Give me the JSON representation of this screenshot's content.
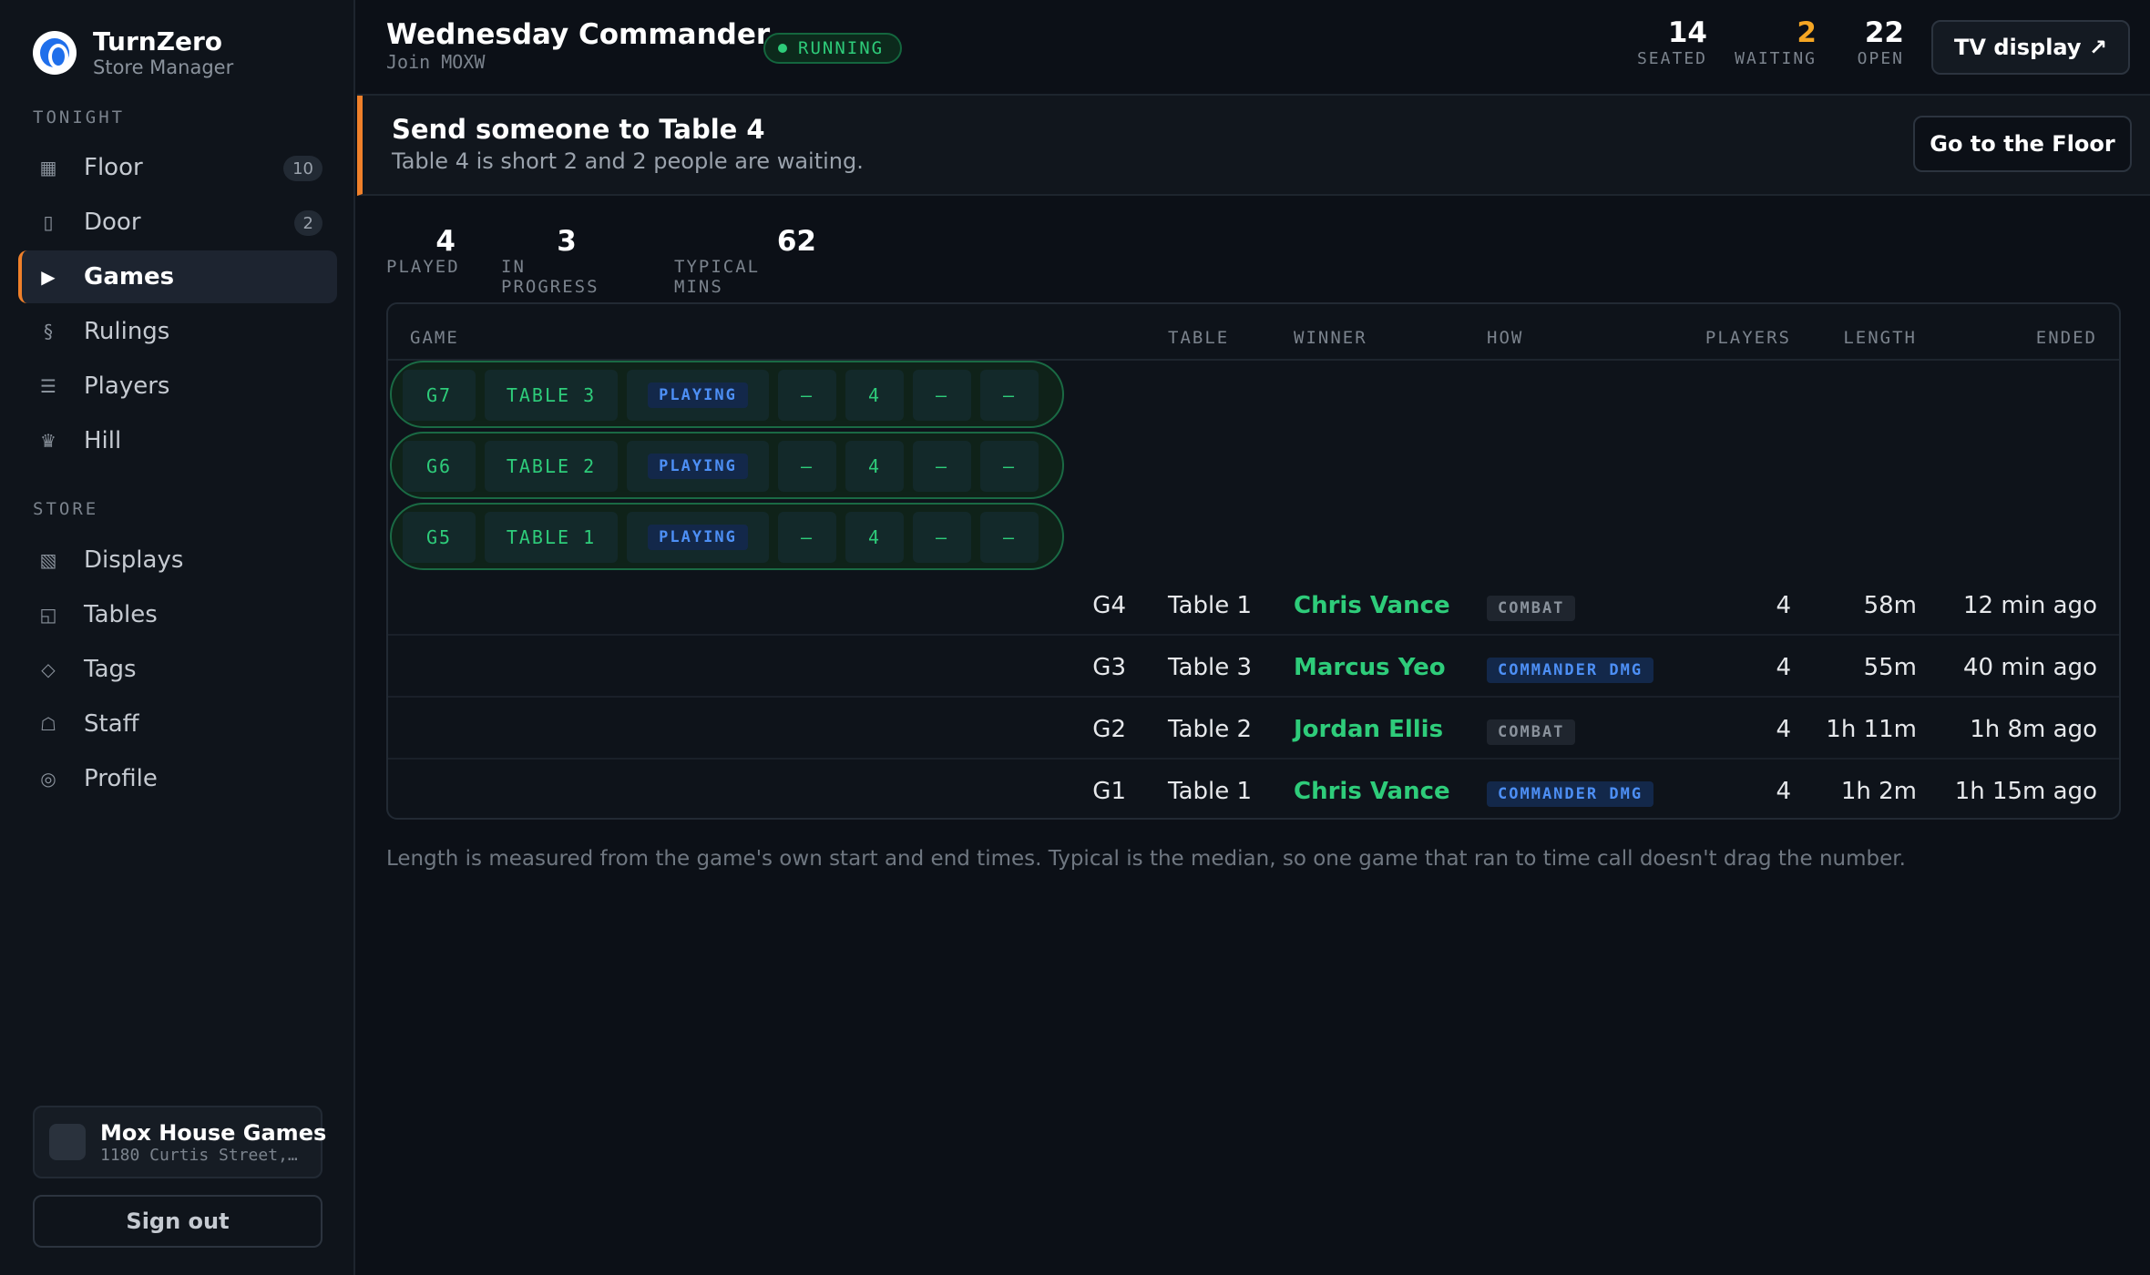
{
  "brand": {
    "name": "TurnZero",
    "subtitle": "Store Manager"
  },
  "sidebar": {
    "section_tonight": "TONIGHT",
    "section_store": "STORE",
    "tonight_items": [
      {
        "label": "Floor",
        "icon": "grid-icon",
        "glyph": "▦",
        "badge": "10"
      },
      {
        "label": "Door",
        "icon": "door-icon",
        "glyph": "▯",
        "badge": "2"
      },
      {
        "label": "Games",
        "icon": "play-icon",
        "glyph": "▶",
        "active": true
      },
      {
        "label": "Rulings",
        "icon": "section-icon",
        "glyph": "§"
      },
      {
        "label": "Players",
        "icon": "list-icon",
        "glyph": "☰"
      },
      {
        "label": "Hill",
        "icon": "crown-icon",
        "glyph": "♛"
      }
    ],
    "store_items": [
      {
        "label": "Displays",
        "icon": "display-icon",
        "glyph": "▧"
      },
      {
        "label": "Tables",
        "icon": "table-icon",
        "glyph": "◱"
      },
      {
        "label": "Tags",
        "icon": "tag-icon",
        "glyph": "◇"
      },
      {
        "label": "Staff",
        "icon": "staff-icon",
        "glyph": "☖"
      },
      {
        "label": "Profile",
        "icon": "profile-icon",
        "glyph": "◎"
      }
    ],
    "store_card": {
      "name": "Mox House Games",
      "address": "1180 Curtis Street,…"
    },
    "sign_out": "Sign out"
  },
  "header": {
    "title": "Wednesday Commander",
    "join": "Join MOXW",
    "status": "RUNNING",
    "stats": [
      {
        "value": "14",
        "label": "SEATED",
        "color": "#ffffff"
      },
      {
        "value": "2",
        "label": "WAITING",
        "color": "#f5a623"
      },
      {
        "value": "22",
        "label": "OPEN",
        "color": "#ffffff"
      }
    ],
    "tv_button": "TV display ↗"
  },
  "alert": {
    "title": "Send someone to Table 4",
    "subtitle": "Table 4 is short 2 and 2 people are waiting.",
    "button": "Go to the Floor"
  },
  "summary": [
    {
      "value": "4",
      "label": "PLAYED"
    },
    {
      "value": "3",
      "label": "IN PROGRESS"
    },
    {
      "value": "62",
      "label": "TYPICAL MINS"
    }
  ],
  "games_table": {
    "columns": [
      "GAME",
      "TABLE",
      "WINNER",
      "HOW",
      "PLAYERS",
      "LENGTH",
      "ENDED"
    ],
    "live_games": [
      {
        "game": "G7",
        "table": "TABLE 3",
        "status": "PLAYING",
        "winner": "–",
        "players": "4",
        "length": "–",
        "ended": "–"
      },
      {
        "game": "G6",
        "table": "TABLE 2",
        "status": "PLAYING",
        "winner": "–",
        "players": "4",
        "length": "–",
        "ended": "–"
      },
      {
        "game": "G5",
        "table": "TABLE 1",
        "status": "PLAYING",
        "winner": "–",
        "players": "4",
        "length": "–",
        "ended": "–"
      }
    ],
    "finished_games": [
      {
        "game": "G4",
        "table": "Table 1",
        "winner": "Chris Vance",
        "how": "COMBAT",
        "players": "4",
        "length": "58m",
        "ended": "12 min ago"
      },
      {
        "game": "G3",
        "table": "Table 3",
        "winner": "Marcus Yeo",
        "how": "COMMANDER DMG",
        "players": "4",
        "length": "55m",
        "ended": "40 min ago"
      },
      {
        "game": "G2",
        "table": "Table 2",
        "winner": "Jordan Ellis",
        "how": "COMBAT",
        "players": "4",
        "length": "1h 11m",
        "ended": "1h 8m ago"
      },
      {
        "game": "G1",
        "table": "Table 1",
        "winner": "Chris Vance",
        "how": "COMMANDER DMG",
        "players": "4",
        "length": "1h 2m",
        "ended": "1h 15m ago"
      }
    ]
  },
  "footnote": "Length is measured from the game's own start and end times. Typical is the median, so one game that ran to time call doesn't drag the number.",
  "colors": {
    "accent": "#f0802a",
    "success": "#2ecc7a",
    "info": "#4d8ff5",
    "warning": "#f5a623"
  }
}
